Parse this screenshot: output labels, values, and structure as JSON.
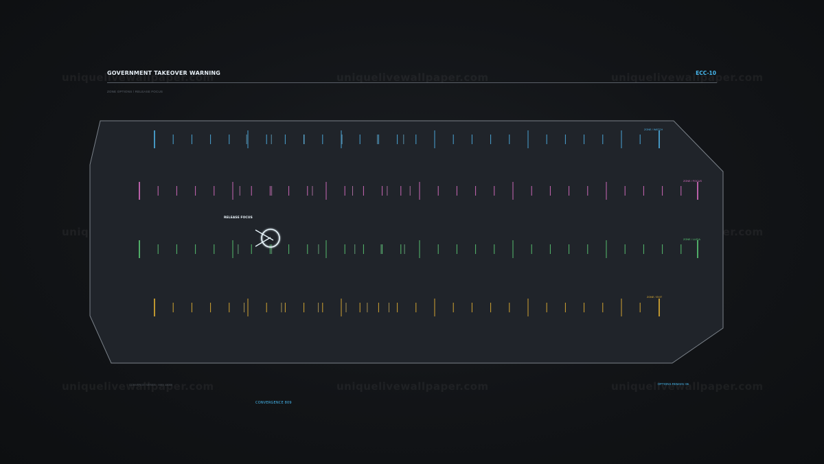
{
  "header": {
    "title": "GOVERNMENT TAKEOVER WARNING",
    "code": "ECC-10",
    "subtitle": "ZONE OPTIONS / RELEASE FOCUS"
  },
  "watermark": "uniquelivewallpaper.com",
  "tracks": [
    {
      "label": "ZONE / WATCH",
      "color": "#4fb4e8",
      "glow": "#7fd6ff",
      "highlight_positions": [
        0.186,
        0.235,
        0.3,
        0.375,
        0.445,
        0.497
      ]
    },
    {
      "label": "ZONE / FOCUS",
      "color": "#e070c8",
      "glow": "#ff9ae6",
      "highlight_positions": [
        0.183,
        0.24,
        0.313,
        0.385,
        0.447,
        0.488
      ]
    },
    {
      "label": "ZONE / LUCIA",
      "color": "#5ccf77",
      "glow": "#8df0a5",
      "highlight_positions": [
        0.18,
        0.24,
        0.324,
        0.389,
        0.436,
        0.478
      ]
    },
    {
      "label": "ZONE / EXIT",
      "color": "#e7b432",
      "glow": "#ffd768",
      "highlight_positions": [
        0.181,
        0.255,
        0.328,
        0.383,
        0.425,
        0.468
      ]
    }
  ],
  "focus_label": "RELEASE FOCUS",
  "footer": {
    "left": "CONVERGE SERIES · MAX 48009",
    "right": "OPTIONS REMAIN: 06",
    "center": "CONVERGENCE 809"
  }
}
